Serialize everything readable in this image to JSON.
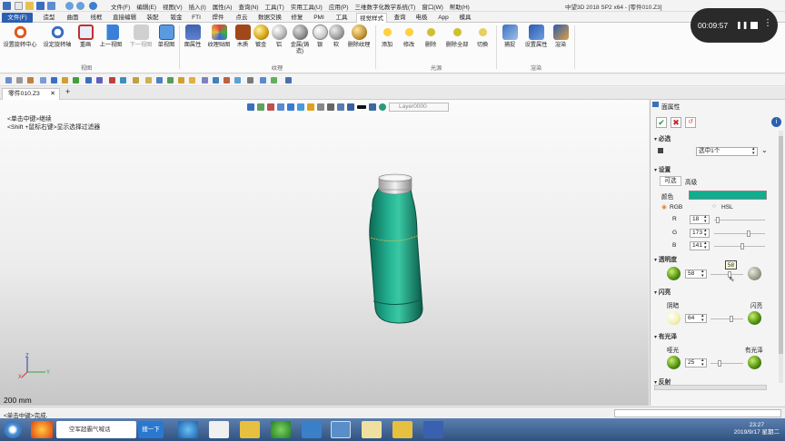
{
  "app": {
    "title": "中望3D 2018 SP2 x64 - [零件010.Z3]"
  },
  "menu": [
    "文件(F)",
    "编辑(E)",
    "视图(V)",
    "插入(I)",
    "属性(A)",
    "查询(N)",
    "工具(T)",
    "实用工具(U)",
    "应用(P)",
    "三维数字化教学系统(T)",
    "窗口(W)",
    "帮助(H)"
  ],
  "ribbon_tabs": [
    "文件(F)",
    "造型",
    "曲面",
    "线框",
    "直接编辑",
    "装配",
    "钣金",
    "FTI",
    "焊件",
    "点云",
    "数据交换",
    "修复",
    "PMI",
    "工具",
    "视觉样式",
    "查询",
    "电极",
    "App",
    "模具"
  ],
  "ribbon": {
    "view": [
      "设置旋转中心",
      "设定旋转轴",
      "重画",
      "上一视图",
      "下一视图",
      "单视图"
    ],
    "texture": [
      "面属性",
      "纹理贴图",
      "木质",
      "镀金",
      "铝",
      "金属(铸造)",
      "银",
      "软",
      "删除纹理"
    ],
    "light": [
      "添加",
      "修改",
      "删除",
      "删除全部",
      "切换"
    ],
    "render": [
      "捕捉",
      "设置属性",
      "渲染"
    ],
    "groups": [
      "视图",
      "纹理",
      "光源",
      "渲染"
    ]
  },
  "doc_tab": "零件010.Z3",
  "layer": "Layer0000",
  "hints": [
    "<单击中键>继续",
    "<Shift +鼠标右键>显示选择过滤器"
  ],
  "scale": "200 mm",
  "axes": {
    "x": "X",
    "y": "Y",
    "z": "Z"
  },
  "panel": {
    "title": "面属性",
    "required": "必选",
    "face_label": "面",
    "face_value": "选中1个",
    "settings": "设置",
    "sub_tabs": [
      "可选",
      "高级"
    ],
    "color_label": "颜色",
    "color": "#128dad",
    "mode": [
      "RGB",
      "HSL"
    ],
    "rgb": [
      {
        "k": "R",
        "v": 18
      },
      {
        "k": "G",
        "v": 173
      },
      {
        "k": "B",
        "v": 141
      }
    ],
    "transparency": {
      "label": "透明度",
      "value": 58,
      "tooltip": "58"
    },
    "flash": {
      "label": "闪亮",
      "left": "阴暗",
      "right": "闪亮",
      "value": 64
    },
    "gloss": {
      "label": "有光泽",
      "left": "哑光",
      "right": "有光泽",
      "value": 25
    },
    "reflect": "反射"
  },
  "status": "<单击中键>完成.",
  "recorder": {
    "time": "00:09:57"
  },
  "taskbar": {
    "item": "空军超霸气喊话",
    "search": "搜一下",
    "time": "23:27",
    "date": "2019/9/17 星期二"
  }
}
